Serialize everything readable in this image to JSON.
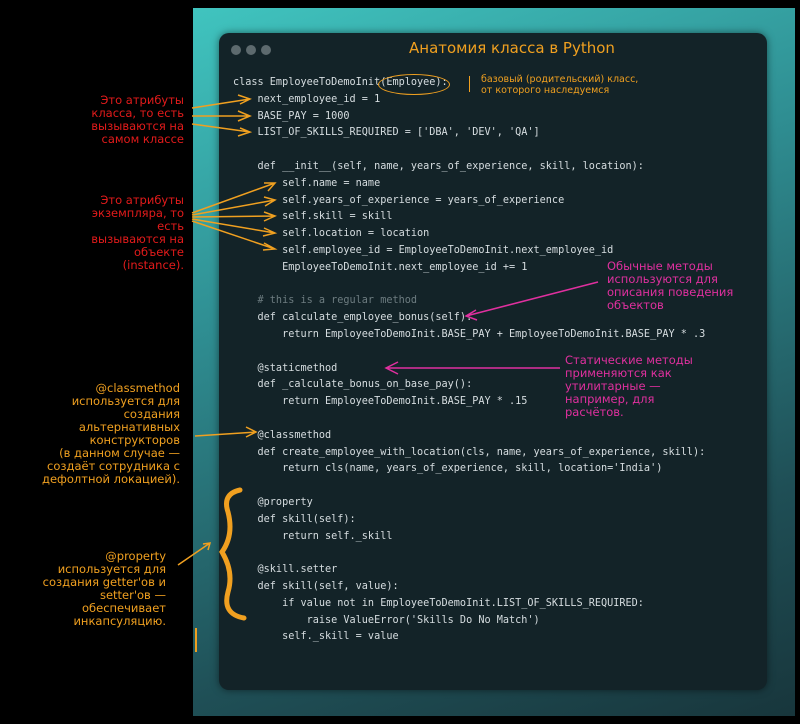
{
  "window": {
    "title": "Анатомия класса в Python",
    "code_lines": [
      "class EmployeeToDemoInit(Employee):",
      "    next_employee_id = 1",
      "    BASE_PAY = 1000",
      "    LIST_OF_SKILLS_REQUIRED = ['DBA', 'DEV', 'QA']",
      "",
      "    def __init__(self, name, years_of_experience, skill, location):",
      "        self.name = name",
      "        self.years_of_experience = years_of_experience",
      "        self.skill = skill",
      "        self.location = location",
      "        self.employee_id = EmployeeToDemoInit.next_employee_id",
      "        EmployeeToDemoInit.next_employee_id += 1",
      "",
      "    # this is a regular method",
      "    def calculate_employee_bonus(self):",
      "        return EmployeeToDemoInit.BASE_PAY + EmployeeToDemoInit.BASE_PAY * .3",
      "",
      "    @staticmethod",
      "    def _calculate_bonus_on_base_pay():",
      "        return EmployeeToDemoInit.BASE_PAY * .15",
      "",
      "    @classmethod",
      "    def create_employee_with_location(cls, name, years_of_experience, skill):",
      "        return cls(name, years_of_experience, skill, location='India')",
      "",
      "    @property",
      "    def skill(self):",
      "        return self._skill",
      "",
      "    @skill.setter",
      "    def skill(self, value):",
      "        if value not in EmployeeToDemoInit.LIST_OF_SKILLS_REQUIRED:",
      "            raise ValueError('Skills Do No Match')",
      "        self._skill = value"
    ],
    "base_class_note": "базовый (родительский) класс,\nот которого наследуемся"
  },
  "annotations": {
    "class_attributes": "Это атрибуты\nкласса, то есть\nвызываются на\nсамом классе",
    "instance_attributes": "Это атрибуты\nэкземпляра, то\nесть\nвызываются на\nобъекте\n(instance).",
    "regular_methods": "Обычные методы\nиспользуются для\nописания поведения\nобъектов",
    "static_methods": "Статические методы\nприменяются как\nутилитарные —\nнапример, для\nрасчётов.",
    "classmethod": "@classmethod\nиспользуется для\nсоздания\nальтернативных\nконструкторов\n(в данном случае —\nсоздаёт сотрудника с\nдефолтной локацией).",
    "property": "@property\nиспользуется для\nсоздания getter'ов и\nsetter'ов —\nобеспечивает\nинкапсуляцию."
  },
  "colors": {
    "orange": "#f0a020",
    "red": "#e31b1b",
    "magenta": "#e0309f",
    "teal": "#40c4bf"
  }
}
